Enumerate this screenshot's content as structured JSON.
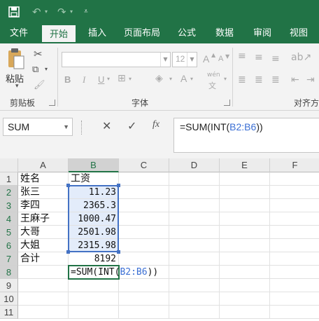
{
  "colors": {
    "brand": "#217346",
    "ribbon_bg": "#f3f3f3",
    "ref_blue": "#3b6fd4",
    "selection_blue": "#4472c4"
  },
  "qat": {
    "save_icon": "save-icon",
    "undo_icon": "undo-icon",
    "redo_icon": "redo-icon",
    "customize_icon": "customize-icon"
  },
  "tabs": [
    "文件",
    "开始",
    "插入",
    "页面布局",
    "公式",
    "数据",
    "审阅",
    "视图"
  ],
  "active_tab": "开始",
  "ribbon": {
    "paste_label": "粘贴",
    "clipboard_label": "剪贴板",
    "font_label": "字体",
    "align_label": "对齐方",
    "font_name": "",
    "font_size": "12",
    "bold": "B",
    "italic": "I",
    "underline": "U",
    "grow_font": "A",
    "shrink_font": "A",
    "phonetic": "wén"
  },
  "formula_bar": {
    "name_box": "SUM",
    "cancel_icon": "✕",
    "enter_icon": "✓",
    "fx_icon": "fx",
    "formula_prefix": "=SUM(INT(",
    "formula_ref": "B2:B6",
    "formula_suffix": "))"
  },
  "grid": {
    "columns": [
      "A",
      "B",
      "C",
      "D",
      "E",
      "F"
    ],
    "rows": [
      "1",
      "2",
      "3",
      "4",
      "5",
      "6",
      "7",
      "8",
      "9",
      "10",
      "11"
    ],
    "cells": {
      "A1": "姓名",
      "B1": "工资",
      "A2": "张三",
      "B2": "11.23",
      "A3": "李四",
      "B3": "2365.3",
      "A4": "王麻子",
      "B4": "1000.47",
      "A5": "大哥",
      "B5": "2501.98",
      "A6": "大姐",
      "B6": "2315.98",
      "A7": "合计",
      "B7": "8192"
    },
    "edit_prefix": "=SUM(INT(",
    "edit_ref": "B2:B6",
    "edit_suffix": "))"
  }
}
